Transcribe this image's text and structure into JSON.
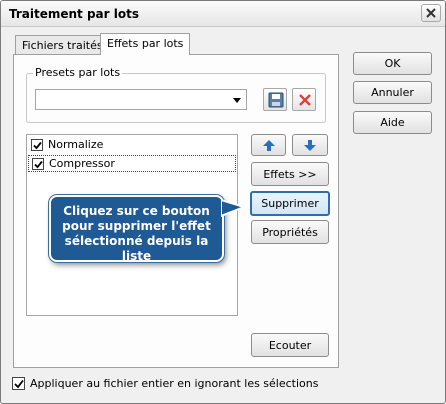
{
  "window": {
    "title": "Traitement par lots"
  },
  "tabs": [
    {
      "label": "Fichiers traités",
      "active": false
    },
    {
      "label": "Effets par lots",
      "active": true
    }
  ],
  "presets": {
    "label": "Presets par lots",
    "value": "",
    "save_icon": "floppy-disk-icon",
    "delete_icon": "red-x-icon"
  },
  "effects": [
    {
      "label": "Normalize",
      "checked": true,
      "selected": false
    },
    {
      "label": "Compressor",
      "checked": true,
      "selected": true
    }
  ],
  "effect_buttons": {
    "move_up_icon": "arrow-up-icon",
    "move_down_icon": "arrow-down-icon",
    "effects": "Effets >>",
    "delete": "Supprimer",
    "properties": "Propriétés",
    "listen": "Ecouter"
  },
  "dialog_buttons": {
    "ok": "OK",
    "cancel": "Annuler",
    "help": "Aide"
  },
  "tooltip": {
    "text": "Cliquez sur ce bouton pour supprimer l'effet sélectionné depuis la liste"
  },
  "footer": {
    "apply_whole_file": "Appliquer au fichier entier en ignorant les sélections",
    "checked": true
  },
  "colors": {
    "tooltip_bg": "#1f5a94",
    "focus_border": "#2f6ea8",
    "arrow_blue": "#2a6fbd",
    "delete_red": "#d9463e"
  }
}
